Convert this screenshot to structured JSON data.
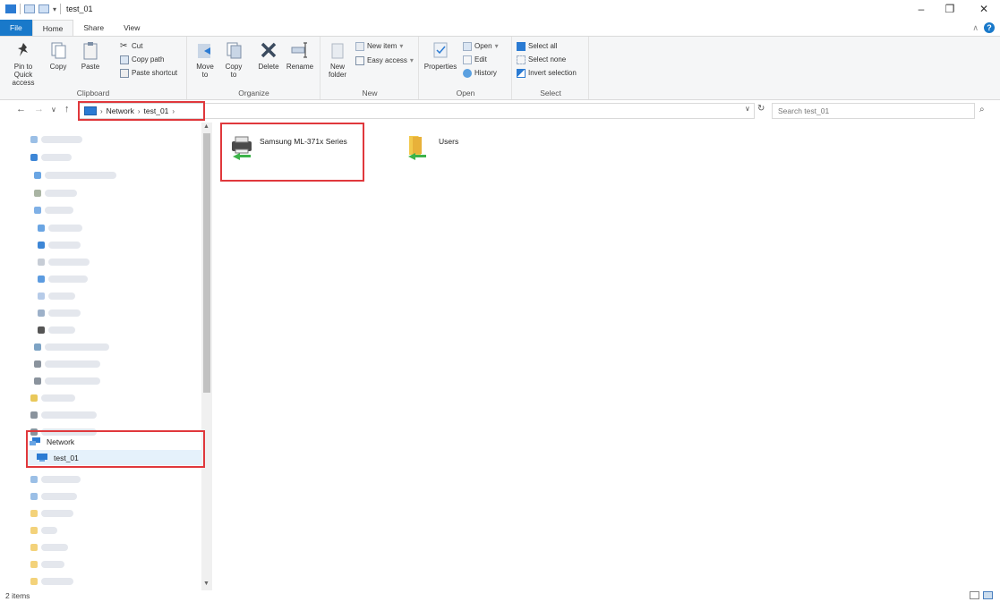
{
  "window": {
    "title": "test_01",
    "controls": {
      "minimize": "–",
      "maximize": "❐",
      "close": "✕"
    }
  },
  "ribbon_tabs": [
    "File",
    "Home",
    "Share",
    "View"
  ],
  "ribbon": {
    "clipboard": {
      "label": "Clipboard",
      "pin": "Pin to Quick access",
      "copy": "Copy",
      "paste": "Paste",
      "cut": "Cut",
      "copy_path": "Copy path",
      "paste_shortcut": "Paste shortcut"
    },
    "organize": {
      "label": "Organize",
      "move_to": "Move to",
      "copy_to": "Copy to",
      "delete": "Delete",
      "rename": "Rename"
    },
    "new": {
      "label": "New",
      "new_folder": "New folder",
      "new_item": "New item",
      "easy_access": "Easy access"
    },
    "open": {
      "label": "Open",
      "properties": "Properties",
      "open": "Open",
      "edit": "Edit",
      "history": "History"
    },
    "select": {
      "label": "Select",
      "select_all": "Select all",
      "select_none": "Select none",
      "invert": "Invert selection"
    }
  },
  "address": {
    "crumbs": [
      "Network",
      "test_01"
    ],
    "search_placeholder": "Search test_01"
  },
  "nav": {
    "network": "Network",
    "selected": "test_01"
  },
  "items": [
    {
      "name": "Samsung ML-371x Series",
      "icon": "printer-icon"
    },
    {
      "name": "Users",
      "icon": "shared-folder-icon"
    }
  ],
  "status": {
    "count": "2 items"
  },
  "colors": {
    "accent": "#1979ca",
    "highlight": "#e0383c",
    "selection": "#cce4f7"
  }
}
